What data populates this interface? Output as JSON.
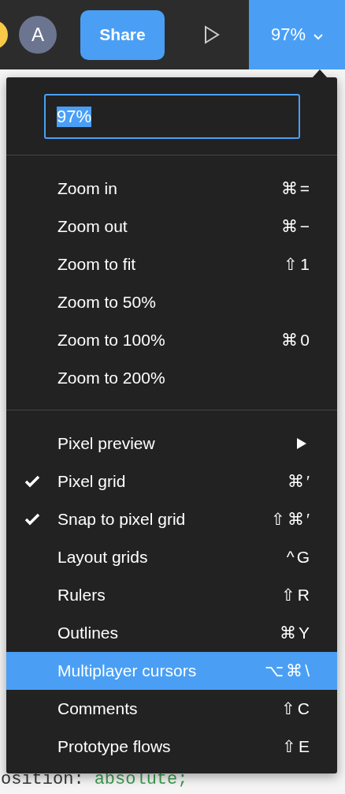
{
  "toolbar": {
    "avatar_initial": "A",
    "share_button": "Share",
    "zoom_button": {
      "label": "97%",
      "expanded": true
    }
  },
  "zoom_menu": {
    "input": {
      "value": "97%"
    },
    "sections": [
      {
        "items": [
          {
            "kind": "item",
            "label": "Zoom in",
            "shortcut": "⌘=",
            "checked": false,
            "selected": false
          },
          {
            "kind": "item",
            "label": "Zoom out",
            "shortcut": "⌘−",
            "checked": false,
            "selected": false
          },
          {
            "kind": "item",
            "label": "Zoom to fit",
            "shortcut": "⇧1",
            "checked": false,
            "selected": false
          },
          {
            "kind": "item",
            "label": "Zoom to 50%",
            "checked": false,
            "selected": false
          },
          {
            "kind": "item",
            "label": "Zoom to 100%",
            "shortcut": "⌘0",
            "checked": false,
            "selected": false
          },
          {
            "kind": "item",
            "label": "Zoom to 200%",
            "checked": false,
            "selected": false
          }
        ]
      },
      {
        "items": [
          {
            "kind": "submenu",
            "label": "Pixel preview",
            "checked": false,
            "selected": false
          },
          {
            "kind": "item",
            "label": "Pixel grid",
            "shortcut": "⌘′",
            "checked": true,
            "selected": false
          },
          {
            "kind": "item",
            "label": "Snap to pixel grid",
            "shortcut": "⇧⌘′",
            "checked": true,
            "selected": false
          },
          {
            "kind": "item",
            "label": "Layout grids",
            "shortcut": "^G",
            "checked": false,
            "selected": false
          },
          {
            "kind": "item",
            "label": "Rulers",
            "shortcut": "⇧R",
            "checked": false,
            "selected": false
          },
          {
            "kind": "item",
            "label": "Outlines",
            "shortcut": "⌘Y",
            "checked": false,
            "selected": false
          },
          {
            "kind": "item",
            "label": "Multiplayer cursors",
            "shortcut": "⌥⌘\\",
            "checked": false,
            "selected": true
          },
          {
            "kind": "item",
            "label": "Comments",
            "shortcut": "⇧C",
            "checked": false,
            "selected": false
          },
          {
            "kind": "item",
            "label": "Prototype flows",
            "shortcut": "⇧E",
            "checked": false,
            "selected": false
          }
        ]
      }
    ]
  },
  "code_line": {
    "property": "osition:",
    "value": "absolute;"
  }
}
